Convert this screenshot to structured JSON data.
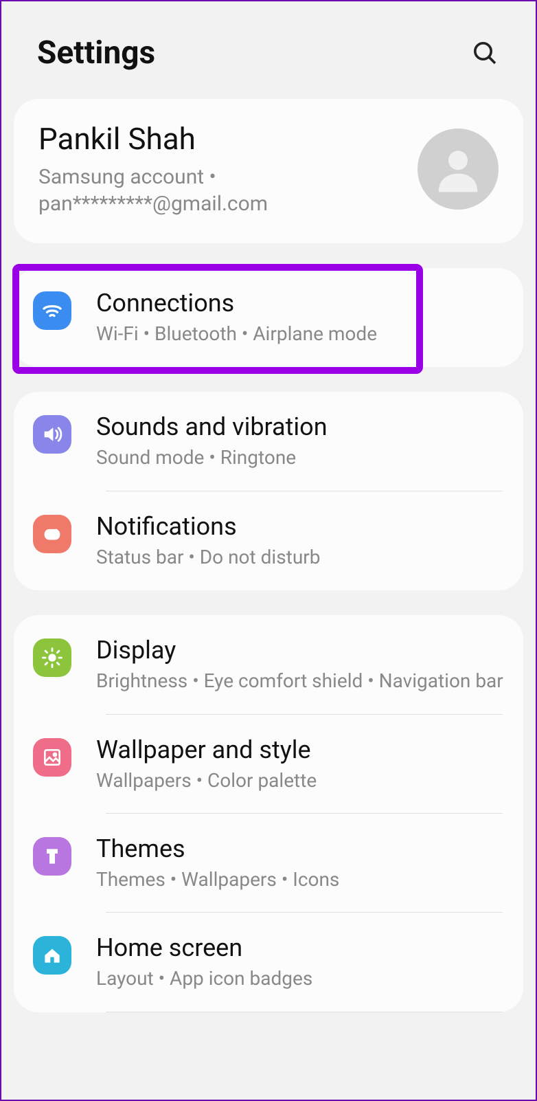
{
  "header": {
    "title": "Settings"
  },
  "account": {
    "name": "Pankil Shah",
    "sub": "Samsung account  •  pan*********@gmail.com"
  },
  "groups": [
    {
      "items": [
        {
          "title": "Connections",
          "sub": "Wi-Fi  •  Bluetooth  •  Airplane mode"
        }
      ]
    },
    {
      "items": [
        {
          "title": "Sounds and vibration",
          "sub": "Sound mode  •  Ringtone"
        },
        {
          "title": "Notifications",
          "sub": "Status bar  •  Do not disturb"
        }
      ]
    },
    {
      "items": [
        {
          "title": "Display",
          "sub": "Brightness  •  Eye comfort shield  •  Navigation bar"
        },
        {
          "title": "Wallpaper and style",
          "sub": "Wallpapers  •  Color palette"
        },
        {
          "title": "Themes",
          "sub": "Themes  •  Wallpapers  •  Icons"
        },
        {
          "title": "Home screen",
          "sub": "Layout  •  App icon badges"
        }
      ]
    }
  ]
}
